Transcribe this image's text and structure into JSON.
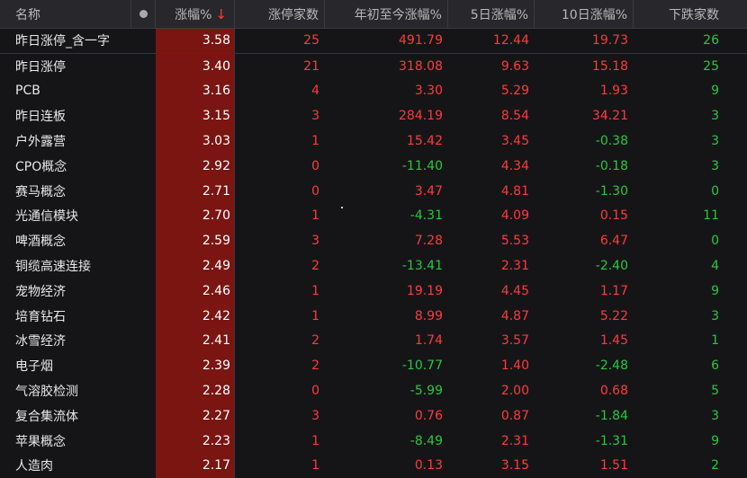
{
  "columns": {
    "name": "名称",
    "pct": "涨幅%",
    "sort_arrow": "↓",
    "limit_up_count": "涨停家数",
    "ytd": "年初至今涨幅%",
    "d5": "5日涨幅%",
    "d10": "10日涨幅%",
    "down_count": "下跌家数"
  },
  "icons": {
    "dot": "column-settings-dot-icon",
    "sort": "sort-desc-arrow-icon"
  },
  "colors": {
    "up": "#ff3a3a",
    "down": "#28c83c",
    "highlight": "#7a1512",
    "background": "#151518"
  },
  "rows": [
    {
      "name": "昨日涨停_含一字",
      "pct": "3.58",
      "limit": "25",
      "ytd": "491.79",
      "d5": "12.44",
      "d10": "19.73",
      "down": "26"
    },
    {
      "name": "昨日涨停",
      "pct": "3.40",
      "limit": "21",
      "ytd": "318.08",
      "d5": "9.63",
      "d10": "15.18",
      "down": "25"
    },
    {
      "name": "PCB",
      "pct": "3.16",
      "limit": "4",
      "ytd": "3.30",
      "d5": "5.29",
      "d10": "1.93",
      "down": "9"
    },
    {
      "name": "昨日连板",
      "pct": "3.15",
      "limit": "3",
      "ytd": "284.19",
      "d5": "8.54",
      "d10": "34.21",
      "down": "3"
    },
    {
      "name": "户外露营",
      "pct": "3.03",
      "limit": "1",
      "ytd": "15.42",
      "d5": "3.45",
      "d10": "-0.38",
      "down": "3"
    },
    {
      "name": "CPO概念",
      "pct": "2.92",
      "limit": "0",
      "ytd": "-11.40",
      "d5": "4.34",
      "d10": "-0.18",
      "down": "3"
    },
    {
      "name": "赛马概念",
      "pct": "2.71",
      "limit": "0",
      "ytd": "3.47",
      "d5": "4.81",
      "d10": "-1.30",
      "down": "0"
    },
    {
      "name": "光通信模块",
      "pct": "2.70",
      "limit": "1",
      "ytd": "-4.31",
      "d5": "4.09",
      "d10": "0.15",
      "down": "11"
    },
    {
      "name": "啤酒概念",
      "pct": "2.59",
      "limit": "3",
      "ytd": "7.28",
      "d5": "5.53",
      "d10": "6.47",
      "down": "0"
    },
    {
      "name": "铜缆高速连接",
      "pct": "2.49",
      "limit": "2",
      "ytd": "-13.41",
      "d5": "2.31",
      "d10": "-2.40",
      "down": "4"
    },
    {
      "name": "宠物经济",
      "pct": "2.46",
      "limit": "1",
      "ytd": "19.19",
      "d5": "4.45",
      "d10": "1.17",
      "down": "9"
    },
    {
      "name": "培育钻石",
      "pct": "2.42",
      "limit": "1",
      "ytd": "8.99",
      "d5": "4.87",
      "d10": "5.22",
      "down": "3"
    },
    {
      "name": "冰雪经济",
      "pct": "2.41",
      "limit": "2",
      "ytd": "1.74",
      "d5": "3.57",
      "d10": "1.45",
      "down": "1"
    },
    {
      "name": "电子烟",
      "pct": "2.39",
      "limit": "2",
      "ytd": "-10.77",
      "d5": "1.40",
      "d10": "-2.48",
      "down": "6"
    },
    {
      "name": "气溶胶检测",
      "pct": "2.28",
      "limit": "0",
      "ytd": "-5.99",
      "d5": "2.00",
      "d10": "0.68",
      "down": "5"
    },
    {
      "name": "复合集流体",
      "pct": "2.27",
      "limit": "3",
      "ytd": "0.76",
      "d5": "0.87",
      "d10": "-1.84",
      "down": "3"
    },
    {
      "name": "苹果概念",
      "pct": "2.23",
      "limit": "1",
      "ytd": "-8.49",
      "d5": "2.31",
      "d10": "-1.31",
      "down": "9"
    },
    {
      "name": "人造肉",
      "pct": "2.17",
      "limit": "1",
      "ytd": "0.13",
      "d5": "3.15",
      "d10": "1.51",
      "down": "2"
    }
  ]
}
